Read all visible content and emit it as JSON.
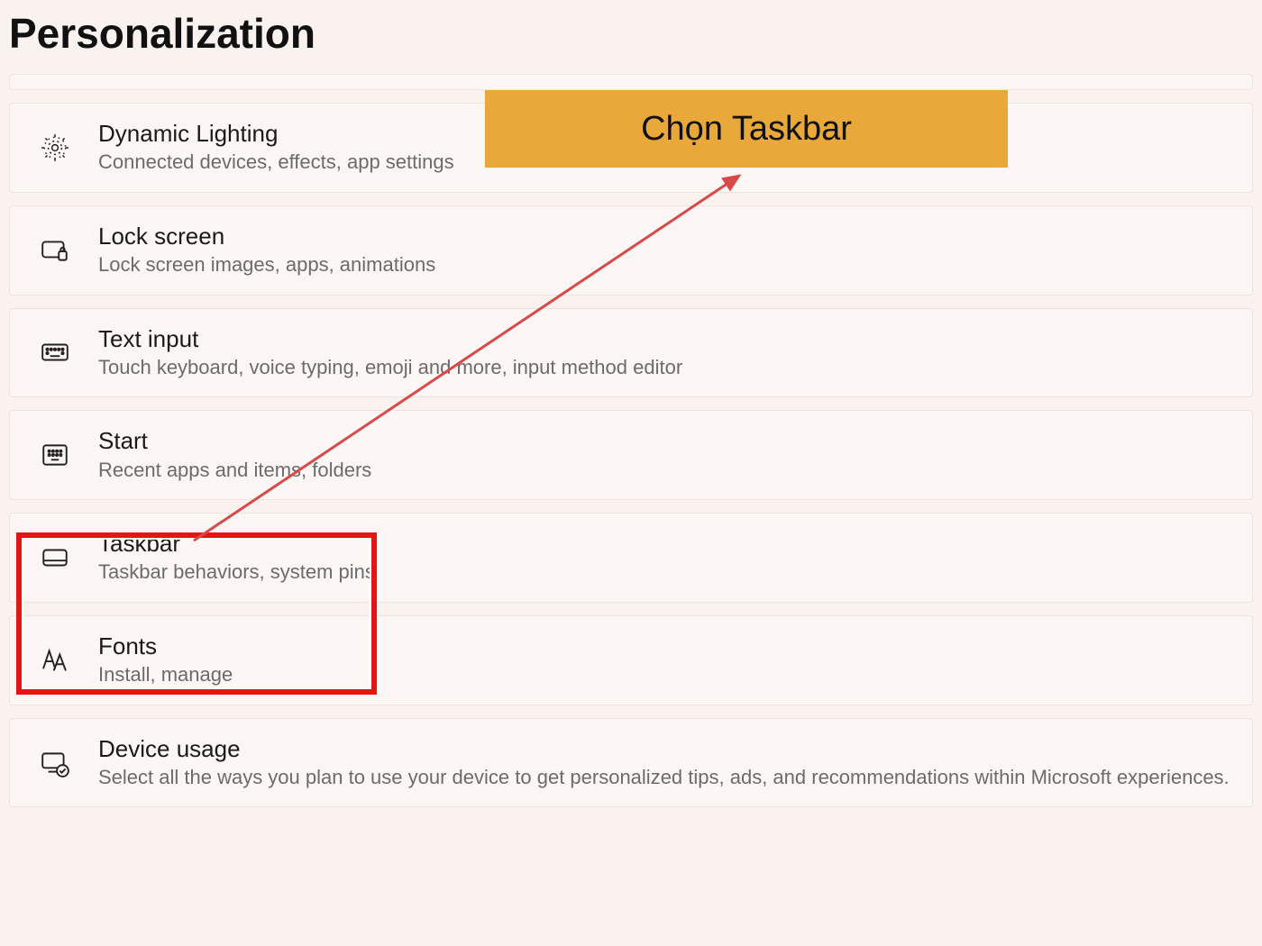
{
  "page_title": "Personalization",
  "callout_label": "Chọn Taskbar",
  "items": [
    {
      "id": "dynamic-lighting",
      "title": "Dynamic Lighting",
      "desc": "Connected devices, effects, app settings",
      "icon": "dynamic-lighting-icon"
    },
    {
      "id": "lock-screen",
      "title": "Lock screen",
      "desc": "Lock screen images, apps, animations",
      "icon": "lock-screen-icon"
    },
    {
      "id": "text-input",
      "title": "Text input",
      "desc": "Touch keyboard, voice typing, emoji and more, input method editor",
      "icon": "keyboard-icon"
    },
    {
      "id": "start",
      "title": "Start",
      "desc": "Recent apps and items, folders",
      "icon": "start-icon"
    },
    {
      "id": "taskbar",
      "title": "Taskbar",
      "desc": "Taskbar behaviors, system pins",
      "icon": "taskbar-icon"
    },
    {
      "id": "fonts",
      "title": "Fonts",
      "desc": "Install, manage",
      "icon": "fonts-icon"
    },
    {
      "id": "device-usage",
      "title": "Device usage",
      "desc": "Select all the ways you plan to use your device to get personalized tips, ads, and recommendations within Microsoft experiences.",
      "icon": "device-usage-icon"
    }
  ]
}
